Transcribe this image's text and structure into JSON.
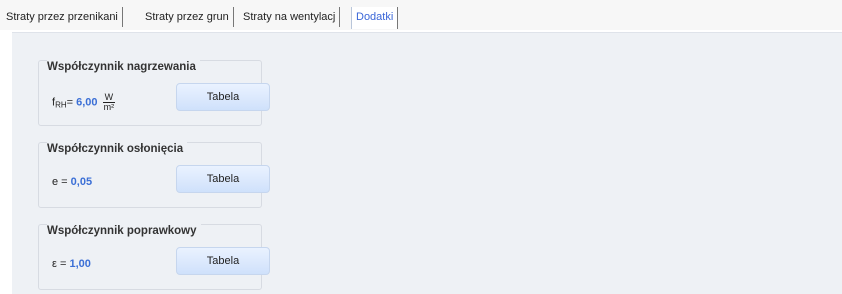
{
  "tabs": [
    {
      "label": "Straty przez przenikani"
    },
    {
      "label": "Straty przez grun"
    },
    {
      "label": "Straty na wentylacj"
    },
    {
      "label": "Dodatki"
    }
  ],
  "groups": [
    {
      "title": "Współczynnik nagrzewania",
      "symbol": "f",
      "subscript": "RH",
      "eq": "=",
      "value": "6,00",
      "unit_num": "W",
      "unit_den": "m²",
      "button_label": "Tabela"
    },
    {
      "title": "Współczynnik osłonięcia",
      "symbol": "e",
      "eq": " =",
      "value": "0,05",
      "button_label": "Tabela"
    },
    {
      "title": "Współczynnik poprawkowy",
      "symbol": "ε",
      "eq": " =",
      "value": "1,00",
      "button_label": "Tabela"
    }
  ]
}
